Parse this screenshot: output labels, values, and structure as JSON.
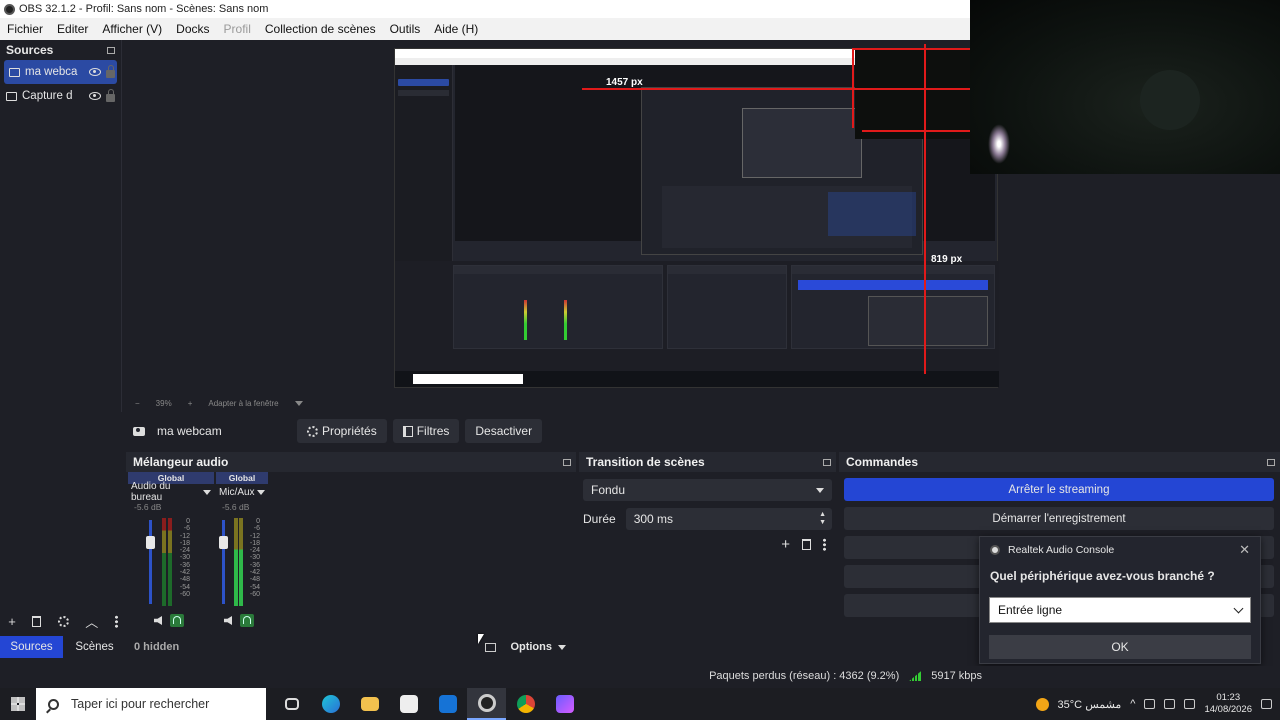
{
  "window": {
    "title": "OBS 32.1.2 - Profil: Sans nom - Scènes: Sans nom"
  },
  "menu": [
    "Fichier",
    "Editer",
    "Afficher (V)",
    "Docks",
    "Profil",
    "Collection de scènes",
    "Outils",
    "Aide (H)"
  ],
  "sources": {
    "title": "Sources",
    "items": [
      {
        "label": "ma webca",
        "selected": true
      },
      {
        "label": "Capture d",
        "selected": false
      }
    ]
  },
  "preview": {
    "measure_width": "1457 px",
    "measure_height": "819 px",
    "zoom": "39%",
    "fit_label": "Adapter à la fenêtre"
  },
  "source_toolbar": {
    "source_name": "ma webcam",
    "properties": "Propriétés",
    "filters": "Filtres",
    "deactivate": "Desactiver"
  },
  "mixer": {
    "title": "Mélangeur audio",
    "channels": [
      {
        "group": "Global",
        "name": "Audio du bureau",
        "db": "-5.6 dB"
      },
      {
        "group": "Global",
        "name": "Mic/Aux",
        "db": "-5.6 dB"
      }
    ],
    "scale": [
      "0",
      "-6",
      "-12",
      "-18",
      "-24",
      "-30",
      "-36",
      "-42",
      "-48",
      "-54",
      "-60"
    ],
    "hidden_label": "0 hidden",
    "options_label": "Options"
  },
  "transition": {
    "title": "Transition de scènes",
    "selected": "Fondu",
    "duration_label": "Durée",
    "duration_value": "300 ms"
  },
  "commands": {
    "title": "Commandes",
    "buttons": [
      {
        "label": "Arrêter le streaming",
        "active": true
      },
      {
        "label": "Démarrer l'enregistrement",
        "active": false
      }
    ]
  },
  "left_tabs": {
    "sources": "Sources",
    "scenes": "Scènes"
  },
  "realtek": {
    "title": "Realtek Audio Console",
    "question": "Quel périphérique avez-vous branché ?",
    "selected": "Entrée ligne",
    "ok": "OK"
  },
  "status": {
    "dropped": "Paquets perdus (réseau) : 4362 (9.2%)",
    "bitrate": "5917 kbps"
  },
  "taskbar": {
    "search_placeholder": "Taper ici pour rechercher",
    "weather": "35°C  مشمس",
    "time": "01:23",
    "date": "14/08/2026"
  },
  "colors": {
    "accent": "#2446d4",
    "panel": "#1e1f26",
    "red_guide": "#e01a1a"
  }
}
